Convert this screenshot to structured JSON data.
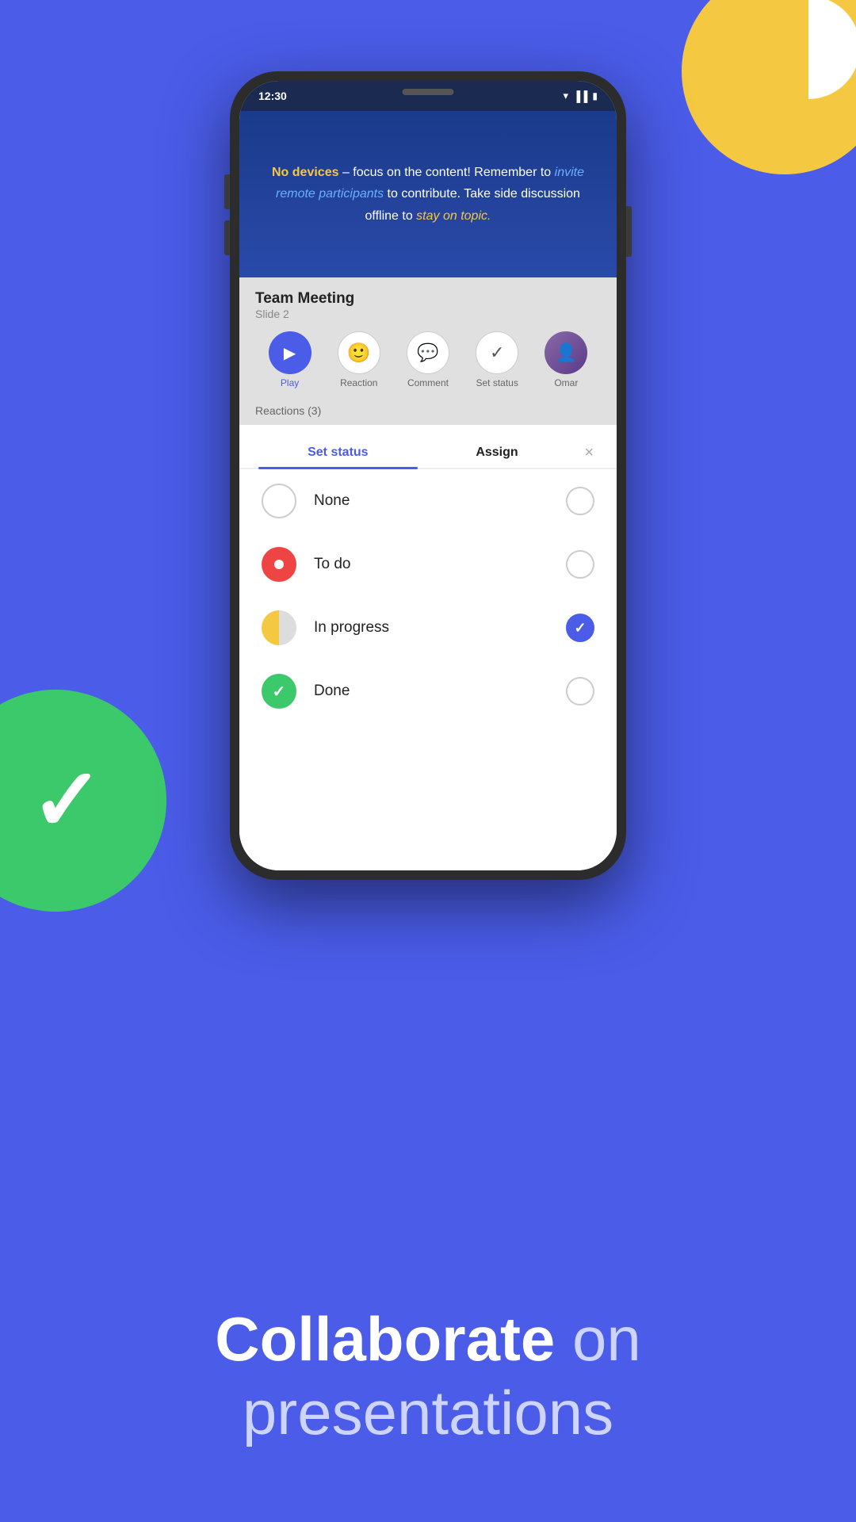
{
  "background_color": "#4a5ce8",
  "status_bar": {
    "time": "12:30",
    "icons": [
      "wifi",
      "signal",
      "battery"
    ]
  },
  "slide": {
    "text_part1": "No devices",
    "text_part2": " – focus on the content! Remember to ",
    "text_link1": "invite remote participants",
    "text_part3": " to contribute. Take side discussion offline to ",
    "text_link2": "stay on topic.",
    "full_text": "No devices – focus on the content! Remember to invite remote participants to contribute. Take side discussion offline to stay on topic."
  },
  "meeting": {
    "title": "Team Meeting",
    "slide_label": "Slide 2"
  },
  "controls": [
    {
      "id": "play",
      "label": "Play",
      "icon": "▶",
      "type": "play"
    },
    {
      "id": "reaction",
      "label": "Reaction",
      "icon": "☺",
      "type": "normal"
    },
    {
      "id": "comment",
      "label": "Comment",
      "icon": "💬",
      "type": "normal"
    },
    {
      "id": "set-status",
      "label": "Set status",
      "icon": "✓",
      "type": "normal"
    },
    {
      "id": "omar",
      "label": "Omar",
      "icon": "",
      "type": "avatar"
    }
  ],
  "reactions_label": "Reactions (3)",
  "sheet": {
    "tab_set_status": "Set status",
    "tab_assign": "Assign",
    "close_icon": "×",
    "status_options": [
      {
        "id": "none",
        "label": "None",
        "icon": "",
        "icon_type": "none",
        "selected": false
      },
      {
        "id": "todo",
        "label": "To do",
        "icon": "",
        "icon_type": "todo",
        "selected": false
      },
      {
        "id": "inprogress",
        "label": "In progress",
        "icon": "",
        "icon_type": "inprogress",
        "selected": true
      },
      {
        "id": "done",
        "label": "Done",
        "icon": "✓",
        "icon_type": "done",
        "selected": false
      }
    ]
  },
  "bottom_text": {
    "bold": "Collaborate",
    "light": "on presentations"
  }
}
